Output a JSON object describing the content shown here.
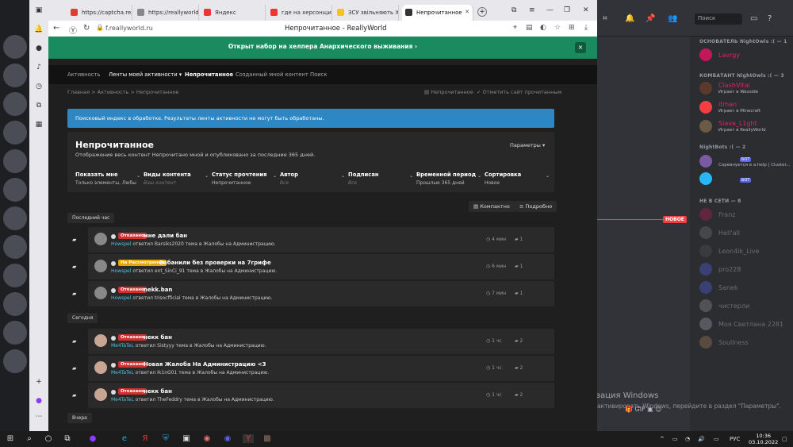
{
  "browser": {
    "tabs": [
      {
        "label": "https://captcha.realli",
        "color": "#e53935"
      },
      {
        "label": "https://reallyworld.r",
        "color": "#888888"
      },
      {
        "label": "Яндекс",
        "color": "#e53935"
      },
      {
        "label": "где на херсонщине",
        "color": "#e53935"
      },
      {
        "label": "ЗСУ звільняють Хер",
        "color": "#f5c518"
      },
      {
        "label": "Непрочитанное",
        "color": "#333333"
      }
    ],
    "url": "f.reallyworld.ru",
    "page_title": "Непрочитанное - ReallyWorld"
  },
  "site": {
    "banner": "Открыт набор на хелпера Анархического выживания",
    "banner_close": "×",
    "nav": [
      "Активность",
      "Ленты моей активности",
      "Непрочитанное",
      "Созданный мной контент",
      "Поиск"
    ],
    "breadcrumb": "Главная  >  Активность  >  Непрочитанное",
    "crumb_right": [
      "Непрочитанное",
      "Отметить сайт прочитанным"
    ],
    "notice": "Поисковый индекс в обработке. Результаты ленты активности не могут быть обработаны.",
    "heading": "Непрочитанное",
    "subheading": "Отображение весь контент Непрочитано мной и опубликовано за последние 365 дней.",
    "params": "Параметры",
    "filters": [
      {
        "label": "Показать мне",
        "value": "Только элементы, Любы"
      },
      {
        "label": "Виды контента",
        "value": "Ваш контент"
      },
      {
        "label": "Статус прочтения",
        "value": "Непрочитанное"
      },
      {
        "label": "Автор",
        "value": "Все"
      },
      {
        "label": "Подписан",
        "value": "Все"
      },
      {
        "label": "Временной период",
        "value": "Прошлые 365 дней"
      },
      {
        "label": "Сортировка",
        "value": "Новое"
      }
    ],
    "views": [
      "Компактно",
      "Подробно"
    ],
    "sections": [
      "Последний час",
      "Сегодня",
      "Вчера"
    ],
    "rows": [
      {
        "badge": "Отказано",
        "badge_color": "#d32f2f",
        "title": "мне дали бан",
        "user": "Howspel",
        "rest": "ответил Barsiks2020 тема в Жалобы на Администрацию.",
        "time": "4 мин",
        "count": "1"
      },
      {
        "badge": "На Рассмотрении",
        "badge_color": "#e6a400",
        "title": "Забанили без проверки на 7грифе",
        "user": "Howspel",
        "rest": "ответил ent_SinCi_91 тема в Жалобы на Администрацию.",
        "time": "6 мин",
        "count": "1"
      },
      {
        "badge": "Отказано",
        "badge_color": "#d32f2f",
        "title": "nekk.ban",
        "user": "Howspel",
        "rest": "ответил trisocfficial тема в Жалобы на Администрацию.",
        "time": "7 мин",
        "count": "1"
      },
      {
        "badge": "Отказано",
        "badge_color": "#d32f2f",
        "title": "некк бан",
        "user": "Me4TaTeL",
        "rest": "ответил Sistyyy тема в Жалобы на Администрацию.",
        "time": "1 чс",
        "count": "2"
      },
      {
        "badge": "Отказано",
        "badge_color": "#d32f2f",
        "title": "Новая Жалоба На Администрацию <3",
        "user": "Me4TaTeL",
        "rest": "ответил Ik1nG01 тема в Жалобы на Администрацию.",
        "time": "1 чс",
        "count": "2"
      },
      {
        "badge": "Отказано",
        "badge_color": "#d32f2f",
        "title": "некк бан",
        "user": "Me4TaTeL",
        "rest": "ответил TheFeddry тема в Жалобы на Администрацию.",
        "time": "1 чс",
        "count": "2"
      }
    ]
  },
  "discord": {
    "search_placeholder": "Поиск",
    "new_badge": "НОВОЕ",
    "sections": [
      "ОСНОВАТЕЛЬ NightOwls :( — 1",
      "КОМБАТАНТ NightOwls :( — 3",
      "NightBots :( — 2",
      "НЕ В СЕТИ — 8"
    ],
    "founder": [
      {
        "name": "Lavrgy",
        "color": "#e91e63"
      }
    ],
    "combatants": [
      {
        "name": "ClashVital",
        "status": "Играет в Wexside",
        "color": "#e91e63"
      },
      {
        "name": "itman",
        "status": "Играет в Minecraft",
        "color": "#e91e63"
      },
      {
        "name": "Slava_L1ght",
        "status": "Играет в ReallyWorld",
        "color": "#e91e63"
      }
    ],
    "bots": [
      {
        "name": "",
        "status": "Соревнуется в a.help | Cluster...",
        "bot": "БОТ"
      },
      {
        "name": "",
        "status": "",
        "bot": "БОТ"
      }
    ],
    "offline": [
      "Franz",
      "Hell'all",
      "Leon4ik_Live",
      "pro228",
      "Sanek",
      "чистерли",
      "Моя Светлана 2281",
      "Soullness"
    ],
    "activate_title": "Активация Windows",
    "activate_text": "Чтобы активировать Windows, перейдите в раздел \"Параметры\"."
  },
  "taskbar": {
    "lang": "РУС",
    "time": "10:36",
    "date": "03.10.2022"
  }
}
